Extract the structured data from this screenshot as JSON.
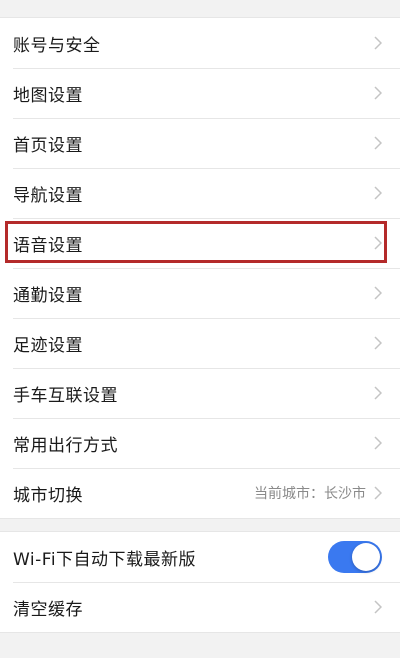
{
  "settings": {
    "items": [
      {
        "label": "账号与安全"
      },
      {
        "label": "地图设置"
      },
      {
        "label": "首页设置"
      },
      {
        "label": "导航设置"
      },
      {
        "label": "语音设置"
      },
      {
        "label": "通勤设置"
      },
      {
        "label": "足迹设置"
      },
      {
        "label": "手车互联设置"
      },
      {
        "label": "常用出行方式"
      },
      {
        "label": "城市切换",
        "value": "当前城市：长沙市"
      }
    ]
  },
  "storage": {
    "wifi_download_label": "Wi-Fi下自动下载最新版",
    "wifi_download_enabled": true,
    "clear_cache_label": "清空缓存"
  },
  "colors": {
    "toggle_on": "#3a79f0",
    "highlight_border": "#b42a2a",
    "chevron": "#c4c4c4"
  }
}
